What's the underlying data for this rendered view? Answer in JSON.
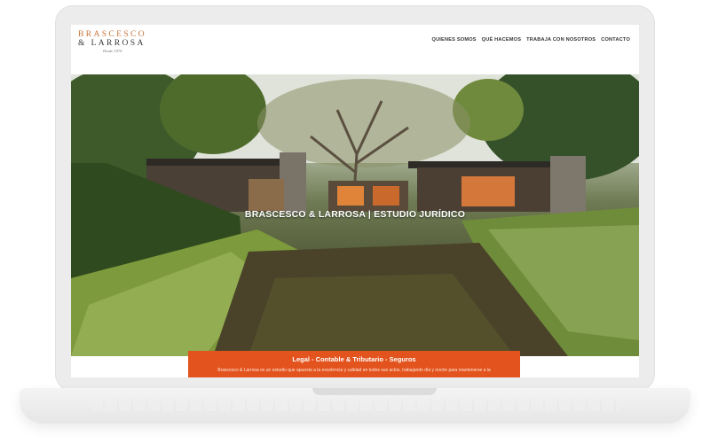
{
  "site": {
    "logo": {
      "line1": "BRASCESCO",
      "line2": "& LARROSA",
      "line3": "Desde 1970"
    },
    "nav": [
      {
        "label": "QUIENES SOMOS"
      },
      {
        "label": "QUÉ HACEMOS"
      },
      {
        "label": "TRABAJA CON NOSOTROS"
      },
      {
        "label": "CONTACTO"
      }
    ]
  },
  "hero": {
    "title": "BRASCESCO & LARROSA | ESTUDIO JURÍDICO"
  },
  "band": {
    "title": "Legal - Contable & Tributario - Seguros",
    "text": "Brascesco & Larrosa es un estudio que apuesta a la excelencia y calidad en todos sus actos, trabajando día y noche para mantenerse a la"
  },
  "colors": {
    "accent": "#e2531d",
    "logo_orange": "#c8743a",
    "frame": "#ececec"
  }
}
